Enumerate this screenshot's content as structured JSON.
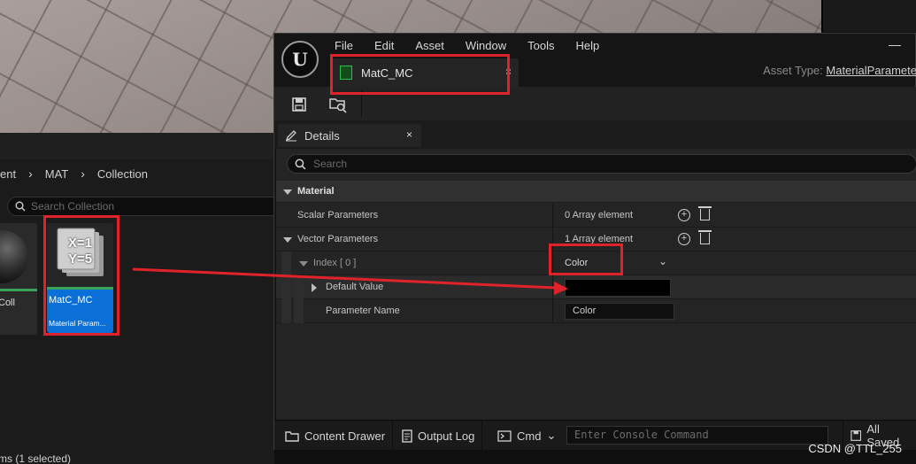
{
  "content_browser": {
    "breadcrumb": [
      "ent",
      "MAT",
      "Collection"
    ],
    "search_placeholder": "Search Collection",
    "tiles": [
      {
        "label": "Coll",
        "sub": "l"
      },
      {
        "label": "MatC_MC",
        "sub": "Material Param...",
        "thumb_text_1": "X=1",
        "thumb_text_2": "Y=5"
      }
    ],
    "status": "ms (1 selected)"
  },
  "window": {
    "menu": [
      "File",
      "Edit",
      "Asset",
      "Window",
      "Tools",
      "Help"
    ],
    "minimize": "—",
    "asset_tab": {
      "label": "MatC_MC",
      "close": "×"
    },
    "asset_type_label": "Asset Type:",
    "asset_type_value": "MaterialParamete",
    "details_tab": {
      "label": "Details",
      "close": "×"
    },
    "search_placeholder": "Search",
    "category": "Material",
    "rows": {
      "scalar_label": "Scalar Parameters",
      "scalar_value": "0 Array element",
      "vector_label": "Vector Parameters",
      "vector_value": "1 Array element",
      "index_label": "Index [ 0 ]",
      "index_value": "Color",
      "default_label": "Default Value",
      "param_name_label": "Parameter Name",
      "param_name_value": "Color"
    },
    "bottom": {
      "content_drawer": "Content Drawer",
      "output_log": "Output Log",
      "cmd": "Cmd",
      "console_placeholder": "Enter Console Command",
      "all_saved": "All Saved"
    }
  },
  "watermark": "CSDN @TTL_255",
  "colors": {
    "highlight": "#e0232a",
    "selection": "#0a6fd6",
    "asset_green": "#3aa35a"
  }
}
